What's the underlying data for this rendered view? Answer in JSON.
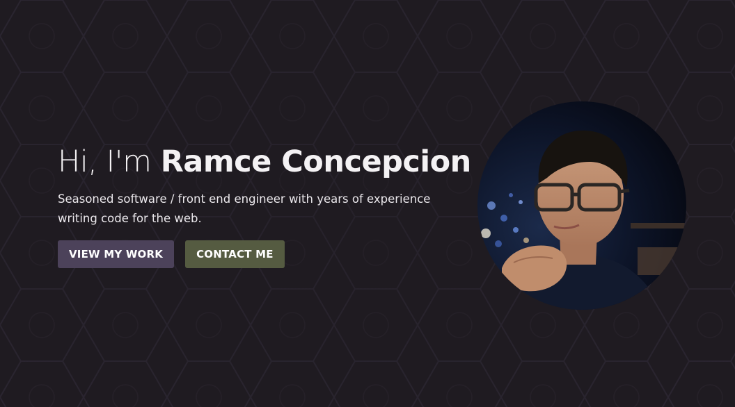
{
  "hero": {
    "greeting": "Hi, I'm ",
    "name": "Ramce Concepcion",
    "subtitle": "Seasoned software / front end engineer with years of experience writing code for the web."
  },
  "buttons": {
    "primary_label": "VIEW MY WORK",
    "secondary_label": "CONTACT ME"
  },
  "colors": {
    "background": "#1f1b21",
    "primary_button": "#4c425a",
    "secondary_button": "#555b41",
    "text": "#f2f0f2"
  },
  "avatar": {
    "description": "profile-photo"
  }
}
